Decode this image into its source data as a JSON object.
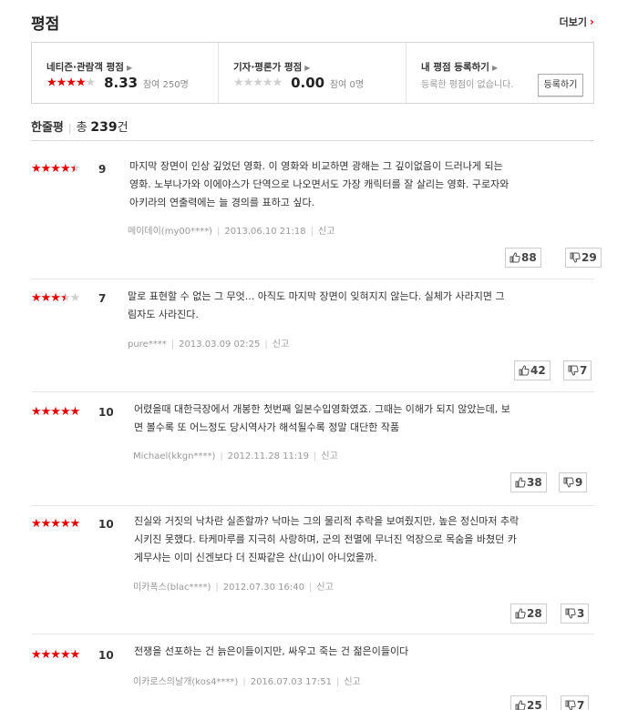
{
  "header": {
    "title": "평점",
    "more_label": "더보기",
    "more_icon": "›"
  },
  "netizen": {
    "label": "네티즌·관람객 평점",
    "stars": "★★★★",
    "stars_off": "★",
    "score": "8.33",
    "participants": "참여 250명"
  },
  "critic": {
    "label": "기자·평론가 평점",
    "stars": "",
    "stars_off": "★★★★★",
    "score": "0.00",
    "participants": "참여 0명"
  },
  "my_rating": {
    "label": "내 평점 등록하기",
    "message": "등록한 평점이 없습니다.",
    "button": "등록하기"
  },
  "count": {
    "label": "한줄평",
    "total_prefix": "총",
    "total": "239",
    "total_suffix": "건"
  },
  "reviews": [
    {
      "stars_on": "★★★★",
      "stars_half": "★",
      "stars_off": "",
      "score": "9",
      "line1": "마지막 장면이 인상 깊었던 영화. 이 영화와 비교하면 광해는 그 깊이없음이 드러나게 되는",
      "line2": "영화. 노부나가와 이에야스가 단역으로 나오면서도 가장 캐릭터를 잘 살리는 영화. 구로자와",
      "line3": "아키라의 연출력에는 늘 경의를 표하고 싶다.",
      "user": "메이데이(my00****)",
      "date": "2013.06.10 21:18",
      "report": "신고",
      "likes": "88",
      "dislikes": "29"
    },
    {
      "stars_on": "★★★",
      "stars_half": "★",
      "stars_off": "★",
      "score": "7",
      "line1": "말로 표현할 수 없는 그 무엇... 아직도 마지막 장면이 잊혀지지 않는다. 실체가 사라지면 그",
      "line2": "림자도 사라진다.",
      "user": "pure****",
      "date": "2013.03.09 02:25",
      "report": "신고",
      "likes": "42",
      "dislikes": "7"
    },
    {
      "stars_on": "★★★★★",
      "stars_half": "",
      "stars_off": "",
      "score": "10",
      "line1": "어렸을때 대한극장에서 개봉한 첫번째 일본수입영화였죠. 그때는 이해가 되지 않았는데, 보",
      "line2": "면 볼수록 또 어느정도 당시역사가 해석될수록 정말 대단한 작품",
      "user": "Michael(kkgn****)",
      "date": "2012.11.28 11:19",
      "report": "신고",
      "likes": "38",
      "dislikes": "9"
    },
    {
      "stars_on": "★★★★★",
      "stars_half": "",
      "stars_off": "",
      "score": "10",
      "line1": "진실와 거짓의 낙차란 실존할까? 낙마는 그의 물리적 추락을 보여줬지만, 높은 정신마저 추락",
      "line2": "시키진 못했다. 타케마루를 지극히 사랑하며, 군의 전멸에 무너진 억장으로 목숨을 바쳤던 카",
      "line3": "게무샤는 이미 신겐보다 더 진짜같은 산(山)이 아니었을까.",
      "user": "미카폭스(blac****)",
      "date": "2012.07.30 16:40",
      "report": "신고",
      "likes": "28",
      "dislikes": "3"
    },
    {
      "stars_on": "★★★★★",
      "stars_half": "",
      "stars_off": "",
      "score": "10",
      "line1": "전쟁을 선포하는 건 늙은이들이지만, 싸우고 죽는 건 젊은이들이다",
      "user": "이카로스의날개(kos4****)",
      "date": "2016.07.03 17:51",
      "report": "신고",
      "likes": "25",
      "dislikes": "7"
    }
  ],
  "colors": {
    "accent": "#e50000",
    "star_off": "#cfcfcf"
  },
  "icons": {
    "like": "thumbs-up-icon",
    "dislike": "thumbs-down-icon"
  }
}
